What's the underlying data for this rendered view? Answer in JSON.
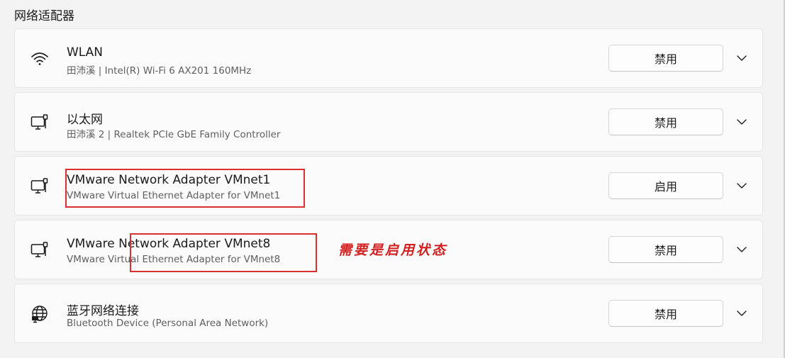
{
  "section_title": "网络适配器",
  "adapters": [
    {
      "name": "WLAN",
      "description": "田沛溪 | Intel(R) Wi-Fi 6 AX201 160MHz",
      "button": "禁用",
      "icon": "wifi-icon"
    },
    {
      "name": "以太网",
      "description": "田沛溪 2 | Realtek PCIe GbE Family Controller",
      "button": "禁用",
      "icon": "ethernet-icon"
    },
    {
      "name": "VMware Network Adapter VMnet1",
      "description": "VMware Virtual Ethernet Adapter for VMnet1",
      "button": "启用",
      "icon": "ethernet-icon"
    },
    {
      "name": "VMware Network Adapter VMnet8",
      "description": "VMware Virtual Ethernet Adapter for VMnet8",
      "button": "禁用",
      "icon": "ethernet-icon"
    },
    {
      "name": "蓝牙网络连接",
      "description": "Bluetooth Device (Personal Area Network)",
      "button": "禁用",
      "icon": "globe-icon"
    }
  ],
  "annotation": {
    "text": "需要是启用状态",
    "color": "#d22020"
  }
}
